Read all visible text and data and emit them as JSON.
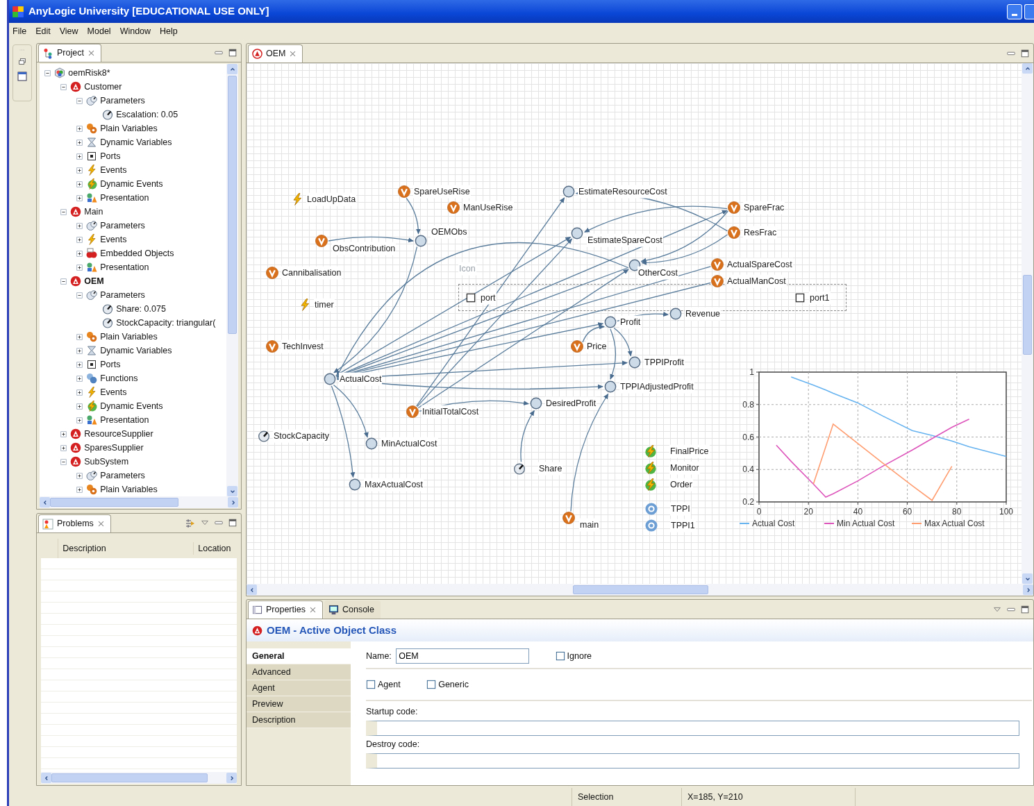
{
  "window": {
    "title": "AnyLogic University [EDUCATIONAL USE ONLY]"
  },
  "menu": [
    "File",
    "Edit",
    "View",
    "Model",
    "Window",
    "Help"
  ],
  "project_tree": {
    "tab": "Project",
    "items": [
      {
        "label": "oemRisk8*",
        "kind": "project",
        "expanded": true,
        "children": [
          {
            "label": "Customer",
            "kind": "class",
            "expanded": true,
            "active": false,
            "children": [
              {
                "label": "Parameters",
                "kind": "parameters",
                "expanded": true,
                "children": [
                  {
                    "label": "Escalation: 0.05",
                    "kind": "parameter"
                  }
                ]
              },
              {
                "label": "Plain Variables",
                "kind": "variables",
                "expanded": false
              },
              {
                "label": "Dynamic Variables",
                "kind": "dynvars",
                "expanded": false
              },
              {
                "label": "Ports",
                "kind": "ports",
                "expanded": false
              },
              {
                "label": "Events",
                "kind": "events",
                "expanded": false
              },
              {
                "label": "Dynamic Events",
                "kind": "dynevents",
                "expanded": false
              },
              {
                "label": "Presentation",
                "kind": "presentation",
                "expanded": false
              }
            ]
          },
          {
            "label": "Main",
            "kind": "class",
            "expanded": true,
            "active": false,
            "children": [
              {
                "label": "Parameters",
                "kind": "parameters",
                "expanded": false
              },
              {
                "label": "Events",
                "kind": "events",
                "expanded": false
              },
              {
                "label": "Embedded Objects",
                "kind": "embedded",
                "expanded": false
              },
              {
                "label": "Presentation",
                "kind": "presentation",
                "expanded": false
              }
            ]
          },
          {
            "label": "OEM",
            "kind": "class",
            "expanded": true,
            "active": true,
            "children": [
              {
                "label": "Parameters",
                "kind": "parameters",
                "expanded": true,
                "children": [
                  {
                    "label": "Share: 0.075",
                    "kind": "parameter"
                  },
                  {
                    "label": "StockCapacity: triangular(",
                    "kind": "parameter"
                  }
                ]
              },
              {
                "label": "Plain Variables",
                "kind": "variables",
                "expanded": false
              },
              {
                "label": "Dynamic Variables",
                "kind": "dynvars",
                "expanded": false
              },
              {
                "label": "Ports",
                "kind": "ports",
                "expanded": false
              },
              {
                "label": "Functions",
                "kind": "functions",
                "expanded": false
              },
              {
                "label": "Events",
                "kind": "events",
                "expanded": false
              },
              {
                "label": "Dynamic Events",
                "kind": "dynevents",
                "expanded": false
              },
              {
                "label": "Presentation",
                "kind": "presentation",
                "expanded": false
              }
            ]
          },
          {
            "label": "ResourceSupplier",
            "kind": "class",
            "expanded": false,
            "active": false
          },
          {
            "label": "SparesSupplier",
            "kind": "class",
            "expanded": false,
            "active": false
          },
          {
            "label": "SubSystem",
            "kind": "class",
            "expanded": true,
            "active": false,
            "children": [
              {
                "label": "Parameters",
                "kind": "parameters",
                "expanded": false
              },
              {
                "label": "Plain Variables",
                "kind": "variables",
                "expanded": false
              }
            ]
          }
        ]
      }
    ]
  },
  "problems": {
    "tab": "Problems",
    "columns": [
      "Description",
      "Location"
    ]
  },
  "editor": {
    "tab": "OEM"
  },
  "canvas": {
    "icon_label": "Icon",
    "nodes": [
      {
        "label": "LoadUpData",
        "kind": "event"
      },
      {
        "label": "SpareUseRise",
        "kind": "variable"
      },
      {
        "label": "EstimateResourceCost",
        "kind": "dynamic"
      },
      {
        "label": "ManUseRise",
        "kind": "variable"
      },
      {
        "label": "SpareFrac",
        "kind": "variable"
      },
      {
        "label": "OEMObs",
        "kind": "dynamic"
      },
      {
        "label": "ObsContribution",
        "kind": "variable"
      },
      {
        "label": "EstimateSpareCost",
        "kind": "dynamic"
      },
      {
        "label": "ResFrac",
        "kind": "variable"
      },
      {
        "label": "Cannibalisation",
        "kind": "variable"
      },
      {
        "label": "OtherCost",
        "kind": "dynamic"
      },
      {
        "label": "ActualSpareCost",
        "kind": "variable"
      },
      {
        "label": "ActualManCost",
        "kind": "variable"
      },
      {
        "label": "port",
        "kind": "port"
      },
      {
        "label": "port1",
        "kind": "port"
      },
      {
        "label": "timer",
        "kind": "event"
      },
      {
        "label": "Revenue",
        "kind": "dynamic"
      },
      {
        "label": "Profit",
        "kind": "dynamic"
      },
      {
        "label": "TechInvest",
        "kind": "variable"
      },
      {
        "label": "Price",
        "kind": "variable"
      },
      {
        "label": "TPPIProfit",
        "kind": "dynamic"
      },
      {
        "label": "ActualCost",
        "kind": "dynamic"
      },
      {
        "label": "TPPIAdjustedProfit",
        "kind": "dynamic"
      },
      {
        "label": "DesiredProfit",
        "kind": "dynamic"
      },
      {
        "label": "InitialTotalCost",
        "kind": "variable"
      },
      {
        "label": "StockCapacity",
        "kind": "parameter"
      },
      {
        "label": "MinActualCost",
        "kind": "dynamic"
      },
      {
        "label": "FinalPrice",
        "kind": "dynevent"
      },
      {
        "label": "Share",
        "kind": "parameter"
      },
      {
        "label": "Monitor",
        "kind": "dynevent"
      },
      {
        "label": "MaxActualCost",
        "kind": "dynamic"
      },
      {
        "label": "Order",
        "kind": "dynevent"
      },
      {
        "label": "TPPI",
        "kind": "function"
      },
      {
        "label": "main",
        "kind": "variable"
      },
      {
        "label": "TPPI1",
        "kind": "function"
      }
    ],
    "chart": {
      "chart_data": {
        "type": "line",
        "grid": true,
        "legend": true,
        "x": [
          7,
          13,
          22,
          27,
          30,
          40,
          50,
          62,
          70,
          78,
          85,
          100
        ],
        "xlim": [
          0,
          100
        ],
        "ylim": [
          0.2,
          1
        ],
        "xticks": [
          0,
          20,
          40,
          60,
          80,
          100
        ],
        "yticks": [
          0.2,
          0.4,
          0.6,
          0.8,
          1
        ],
        "series": [
          {
            "name": "Actual Cost",
            "color": "#66b3f0",
            "values": [
              null,
              0.97,
              0.92,
              0.89,
              0.87,
              0.81,
              0.73,
              0.64,
              0.61,
              0.575,
              0.54,
              0.48
            ]
          },
          {
            "name": "Min Actual Cost",
            "color": "#dd55bb",
            "values": [
              0.55,
              0.45,
              0.31,
              0.23,
              0.25,
              0.33,
              0.42,
              0.52,
              0.59,
              0.66,
              0.71,
              null
            ]
          },
          {
            "name": "Max Actual Cost",
            "color": "#ff9d70",
            "values": [
              null,
              null,
              0.31,
              0.54,
              0.68,
              0.56,
              0.44,
              0.3,
              0.21,
              0.42,
              null,
              null
            ]
          }
        ]
      }
    }
  },
  "properties": {
    "tabs": [
      {
        "label": "Properties",
        "selected": true
      },
      {
        "label": "Console",
        "selected": false
      }
    ],
    "title": "OEM - Active Object Class",
    "sections": [
      {
        "label": "General",
        "selected": true
      },
      {
        "label": "Advanced",
        "selected": false
      },
      {
        "label": "Agent",
        "selected": false
      },
      {
        "label": "Preview",
        "selected": false
      },
      {
        "label": "Description",
        "selected": false
      }
    ],
    "name_field": {
      "label": "Name:",
      "value": "OEM"
    },
    "checkboxes": [
      {
        "label": "Ignore",
        "checked": false
      },
      {
        "label": "Agent",
        "checked": false
      },
      {
        "label": "Generic",
        "checked": false
      }
    ],
    "code_fields": [
      {
        "label": "Startup code:"
      },
      {
        "label": "Destroy code:"
      }
    ]
  },
  "status_bar": {
    "cells": [
      "Selection",
      "X=185, Y=210"
    ]
  }
}
